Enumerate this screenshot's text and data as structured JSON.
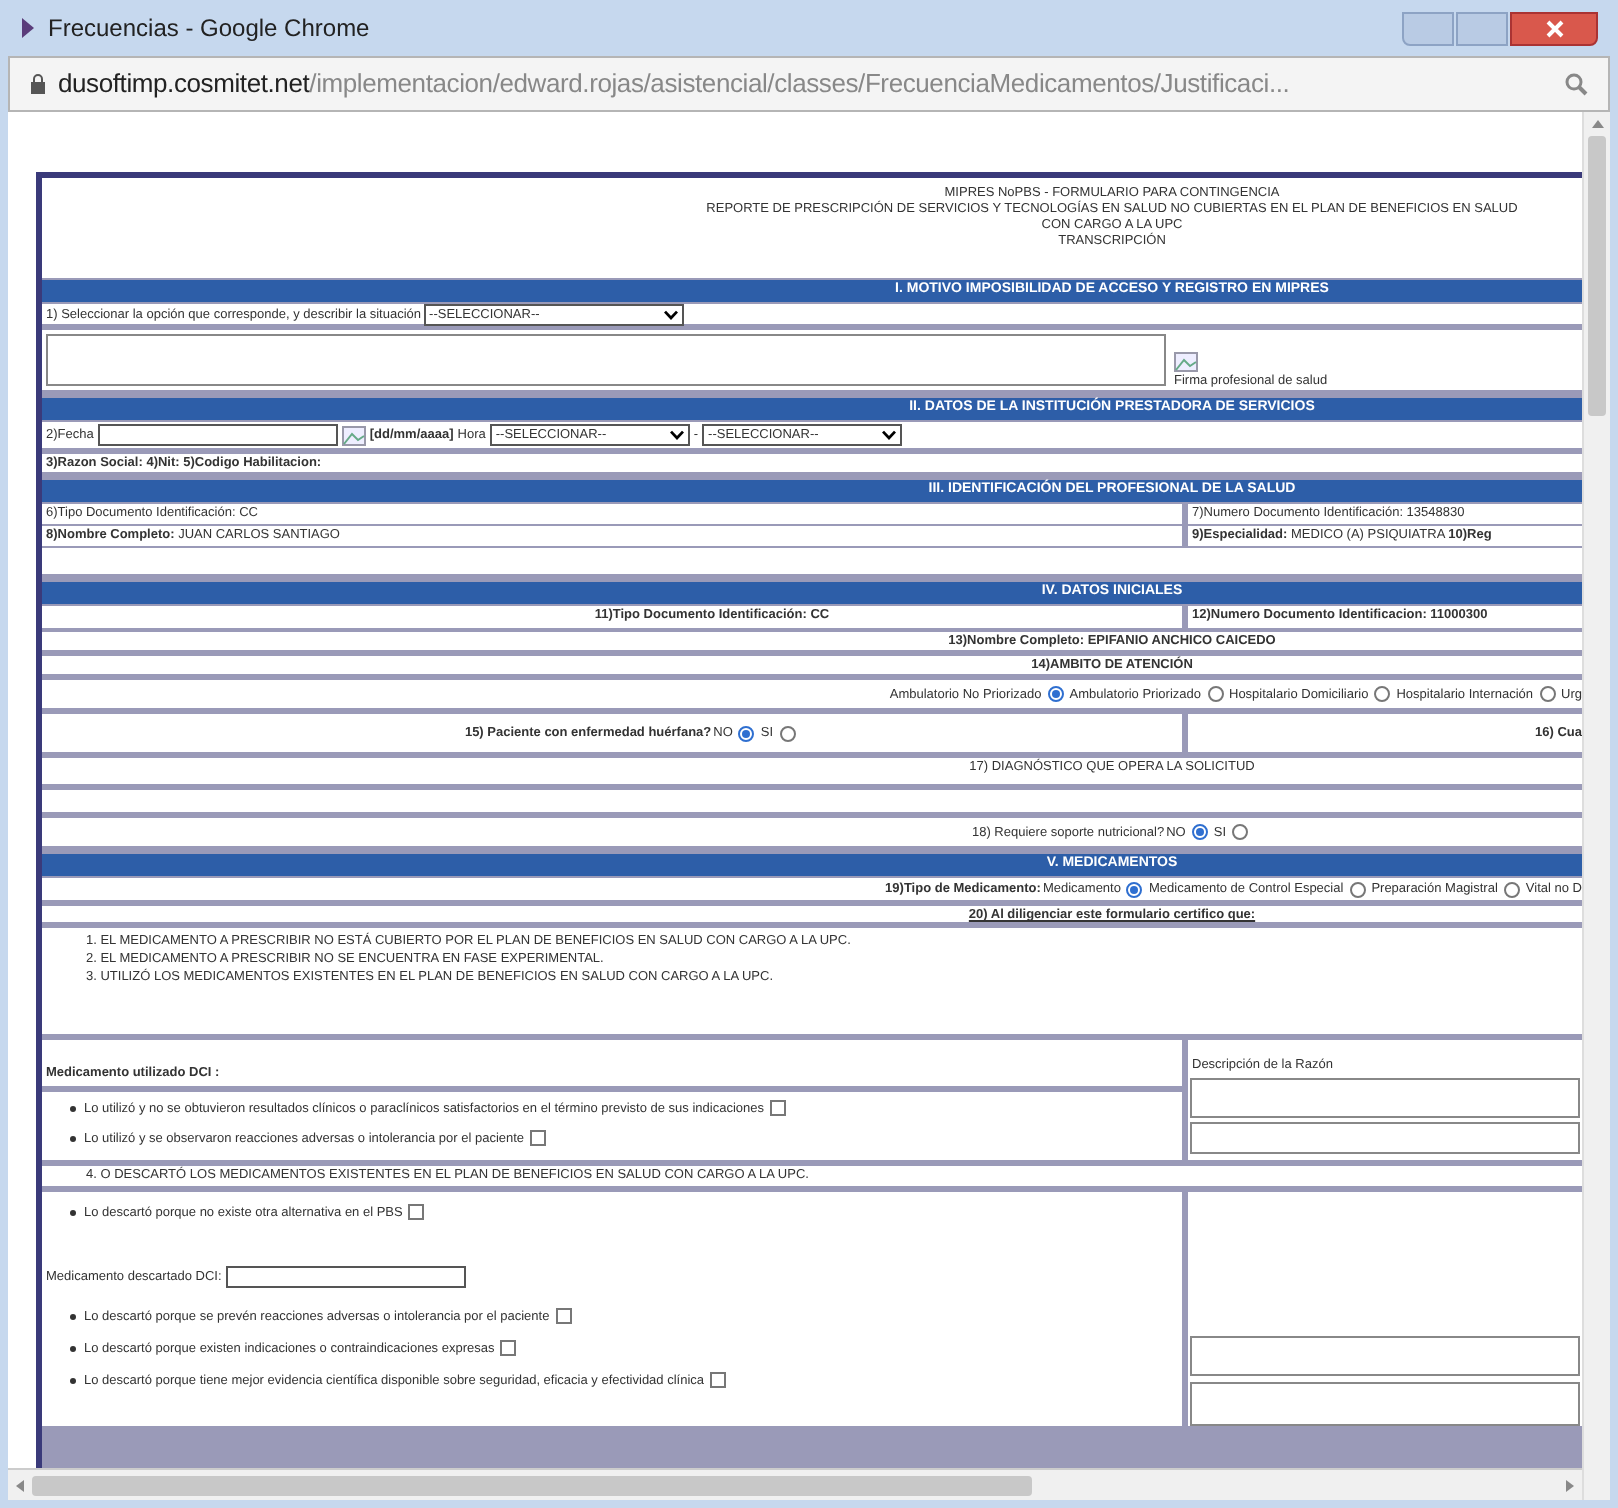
{
  "window": {
    "title": "Frecuencias - Google Chrome"
  },
  "address_bar": {
    "host": "dusoftimp.cosmitet.net",
    "path": "/implementacion/edward.rojas/asistencial/classes/FrecuenciaMedicamentos/Justificaci..."
  },
  "header": [
    "MIPRES NoPBS - FORMULARIO PARA CONTINGENCIA",
    "REPORTE DE PRESCRIPCIÓN DE SERVICIOS Y TECNOLOGÍAS EN SALUD NO CUBIERTAS EN EL PLAN DE BENEFICIOS EN SALUD CON CARGO A LA UPC",
    "TRANSCRIPCIÓN"
  ],
  "section_1": {
    "title": "I. MOTIVO IMPOSIBILIDAD DE ACCESO Y REGISTRO EN MIPRES",
    "question": "1) Seleccionar la opción que corresponde, y describir la situación",
    "select": "--SELECCIONAR--",
    "signature_label": "Firma profesional de salud"
  },
  "section_2": {
    "title": "II. DATOS DE LA INSTITUCIÓN PRESTADORA DE SERVICIOS",
    "date_label": "2)Fecha",
    "date_format": "[dd/mm/aaaa]",
    "hour_label": "Hora",
    "hour_select": "--SELECCIONAR--",
    "separator": "-",
    "minute_select": "--SELECCIONAR--",
    "institution_line": "3)Razon Social: 4)Nit: 5)Codigo Habilitacion:"
  },
  "section_3": {
    "title": "III. IDENTIFICACIÓN DEL PROFESIONAL DE LA SALUD",
    "rows": [
      [
        "6)Tipo Documento Identificación: CC",
        "7)Numero Documento Identificación: 13548830"
      ],
      [
        "**8)Nombre Completo:** JUAN CARLOS SANTIAGO",
        "**9)Especialidad:** MEDICO (A) PSIQUIATRA **10)Reg**"
      ]
    ]
  },
  "section_4": {
    "title": "IV. DATOS INICIALES",
    "document_type": "11)Tipo Documento Identificación: CC",
    "document_number": "12)Numero Documento Identificacion: 11000300",
    "full_name": "13)Nombre Completo: EPIFANIO ANCHICO CAICEDO",
    "scope_title": "14)AMBITO DE ATENCIÓN",
    "scope_options": [
      {
        "label": "Ambulatorio No Priorizado",
        "selected": true
      },
      {
        "label": "Ambulatorio Priorizado",
        "selected": false
      },
      {
        "label": "Hospitalario Domiciliario",
        "selected": false
      },
      {
        "label": "Hospitalario Internación",
        "selected": false
      }
    ],
    "scope_cut_label": "Urg",
    "orphan_question": "15) Paciente con enfermedad huérfana?",
    "orphan_options": [
      {
        "label": "NO",
        "selected": true
      },
      {
        "label": "SI",
        "selected": false
      }
    ],
    "field_16": "16) Cua",
    "diagnosis_title": "17) DIAGNÓSTICO QUE OPERA LA SOLICITUD",
    "nutrition_question": "18) Requiere soporte nutricional?",
    "nutrition_options": [
      {
        "label": "NO",
        "selected": true
      },
      {
        "label": "SI",
        "selected": false
      }
    ]
  },
  "section_5": {
    "title": "V. MEDICAMENTOS",
    "type_label": "19)Tipo de Medicamento:",
    "type_options": [
      {
        "label": "Medicamento",
        "selected": true
      },
      {
        "label": "Medicamento de Control Especial",
        "selected": false
      },
      {
        "label": "Preparación Magistral",
        "selected": false
      }
    ],
    "type_cut_label": "Vital no D",
    "certify_title": "20) Al diligenciar este formulario certifico que:",
    "certify_items": [
      "1. EL MEDICAMENTO A PRESCRIBIR NO ESTÁ CUBIERTO POR EL PLAN DE BENEFICIOS EN SALUD CON CARGO A LA UPC.",
      "2. EL MEDICAMENTO A PRESCRIBIR NO SE ENCUENTRA EN FASE EXPERIMENTAL.",
      "3. UTILIZÓ LOS MEDICAMENTOS EXISTENTES EN EL PLAN DE BENEFICIOS EN SALUD CON CARGO A LA UPC."
    ],
    "used_label": "Medicamento utilizado DCI :",
    "reason_label": "Descripción de la Razón",
    "used_reasons": [
      {
        "text": "Lo utilizó y no se obtuvieron resultados clínicos o paraclínicos satisfactorios en el término previsto de sus indicaciones",
        "checked": false
      },
      {
        "text": "Lo utilizó y se observaron reacciones adversas o intolerancia por el paciente",
        "checked": false
      }
    ],
    "discarded_heading": "4. O DESCARTÓ LOS MEDICAMENTOS EXISTENTES EN EL PLAN DE BENEFICIOS EN SALUD CON CARGO A LA UPC.",
    "no_alternative": {
      "text": "Lo descartó porque no existe otra alternativa en el PBS",
      "checked": false
    },
    "discarded_label": "Medicamento descartado DCI:",
    "discarded_reasons": [
      {
        "text": "Lo descartó porque se prevén reacciones adversas o intolerancia por el paciente",
        "checked": false
      },
      {
        "text": "Lo descartó porque existen indicaciones o contraindicaciones expresas",
        "checked": false
      },
      {
        "text": "Lo descartó porque tiene mejor evidencia científica disponible sobre seguridad, eficacia y efectividad clínica",
        "checked": false
      }
    ]
  }
}
